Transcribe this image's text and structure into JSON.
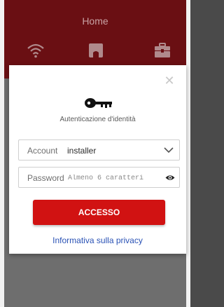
{
  "header": {
    "title": "Home",
    "icons": [
      "wifi-icon",
      "home-icon",
      "tools-icon"
    ]
  },
  "dialog": {
    "close_icon": "close-icon",
    "key_icon": "key-icon",
    "title": "Autenticazione d'identità",
    "account": {
      "label": "Account",
      "value": "installer"
    },
    "password": {
      "label": "Password",
      "placeholder": "Almeno 6 caratteri"
    },
    "login_label": "ACCESSO",
    "privacy_label": "Informativa sulla privacy"
  },
  "colors": {
    "header": "#6a0f13",
    "accent": "#d11212",
    "link": "#2a52b5"
  }
}
